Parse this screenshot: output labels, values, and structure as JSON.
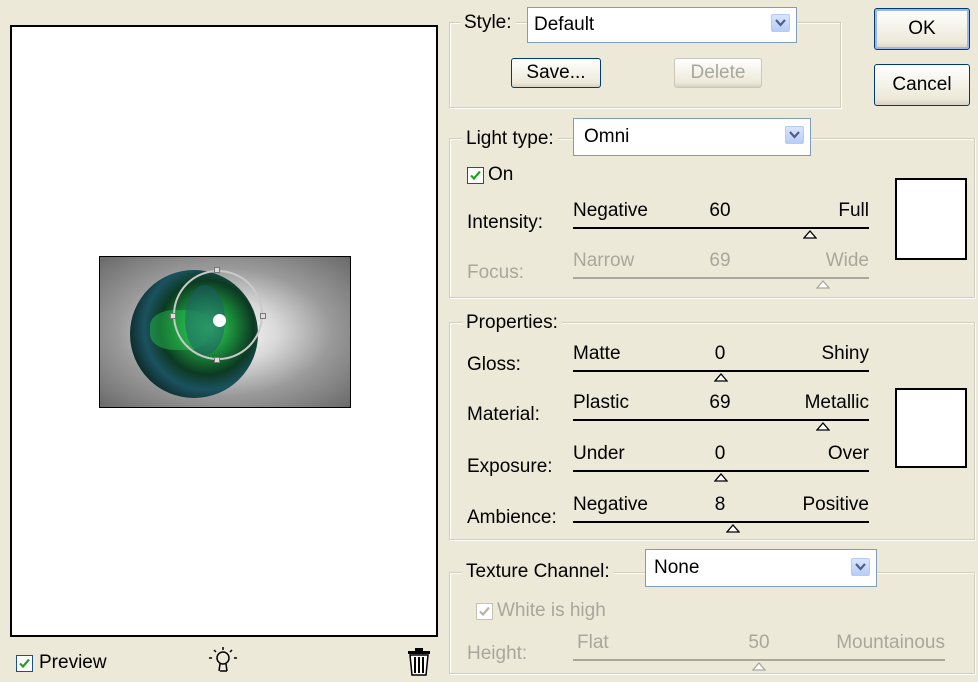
{
  "style": {
    "label": "Style:",
    "value": "Default",
    "save_label": "Save...",
    "delete_label": "Delete"
  },
  "buttons": {
    "ok": "OK",
    "cancel": "Cancel"
  },
  "light": {
    "type_label": "Light type:",
    "type_value": "Omni",
    "on_label": "On",
    "on_checked": true,
    "intensity": {
      "label": "Intensity:",
      "min_label": "Negative",
      "max_label": "Full",
      "value": "60",
      "fraction": 0.8
    },
    "focus": {
      "label": "Focus:",
      "min_label": "Narrow",
      "max_label": "Wide",
      "value": "69",
      "fraction": 0.845,
      "enabled": false
    }
  },
  "properties": {
    "legend": "Properties:",
    "gloss": {
      "label": "Gloss:",
      "min_label": "Matte",
      "max_label": "Shiny",
      "value": "0",
      "fraction": 0.5
    },
    "material": {
      "label": "Material:",
      "min_label": "Plastic",
      "max_label": "Metallic",
      "value": "69",
      "fraction": 0.845
    },
    "exposure": {
      "label": "Exposure:",
      "min_label": "Under",
      "max_label": "Over",
      "value": "0",
      "fraction": 0.5
    },
    "ambience": {
      "label": "Ambience:",
      "min_label": "Negative",
      "max_label": "Positive",
      "value": "8",
      "fraction": 0.54
    }
  },
  "texture": {
    "channel_label": "Texture Channel:",
    "channel_value": "None",
    "white_is_high_label": "White is high",
    "white_is_high_checked": true,
    "height": {
      "label": "Height:",
      "min_label": "Flat",
      "max_label": "Mountainous",
      "value": "50",
      "fraction": 0.5
    }
  },
  "preview": {
    "label": "Preview",
    "checked": true
  },
  "icons": [
    "lightbulb-icon",
    "trash-icon",
    "chevron-down-icon",
    "checkmark-icon"
  ],
  "colors": {
    "dialog_bg": "#ece9d8",
    "accent": "#7f9db9",
    "disabled_text": "#a9a79c"
  }
}
